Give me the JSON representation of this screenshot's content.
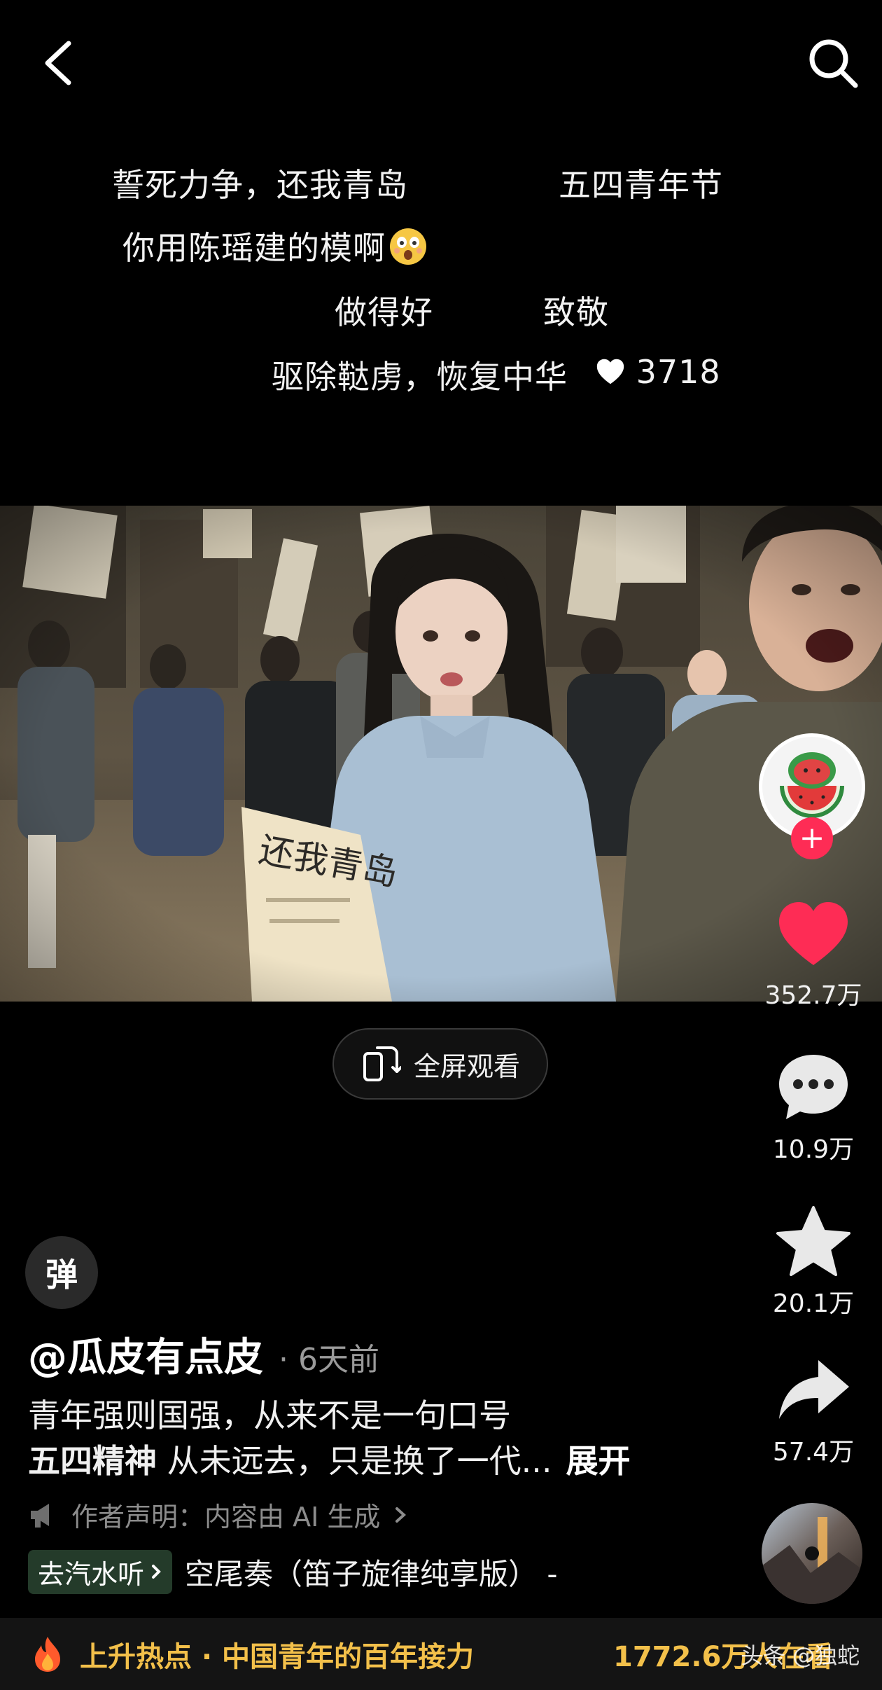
{
  "danmaku": [
    {
      "text": "誓死力争，还我青岛"
    },
    {
      "text": "五四青年节"
    },
    {
      "text": "你用陈瑶建的模啊"
    },
    {
      "text": "做得好"
    },
    {
      "text": "致敬"
    },
    {
      "text": "驱除鞑虏，恢复中华",
      "likes": "3718"
    }
  ],
  "video_overlay": {
    "fullscreen_label": "全屏观看"
  },
  "actions": {
    "likes": "352.7万",
    "comments": "10.9万",
    "favorites": "20.1万",
    "shares": "57.4万"
  },
  "danmaku_toggle": "弹",
  "post": {
    "author": "@瓜皮有点皮",
    "time": "· 6天前",
    "caption_line1": "青年强则国强，从来不是一句口号",
    "caption_line2_bold": "五四精神",
    "caption_line2_rest": " 从未远去，只是换了一代...",
    "expand_label": "展开",
    "declaration": "作者声明：内容由 AI 生成",
    "listen_label": "去汽水听",
    "music_title": "空尾奏（笛子旋律纯享版） -"
  },
  "hot": {
    "label": "上升热点 · 中国青年的百年接力",
    "count": "1772.6万人在看"
  },
  "watermark": "头条 @独蛇",
  "colors": {
    "accent_red": "#fe2c55",
    "hot_yellow": "#f3c04a",
    "background": "#000000"
  },
  "icons": [
    "back-icon",
    "search-icon",
    "heart-icon",
    "comment-icon",
    "star-icon",
    "share-icon",
    "fullscreen-icon",
    "megaphone-icon",
    "fire-icon"
  ]
}
